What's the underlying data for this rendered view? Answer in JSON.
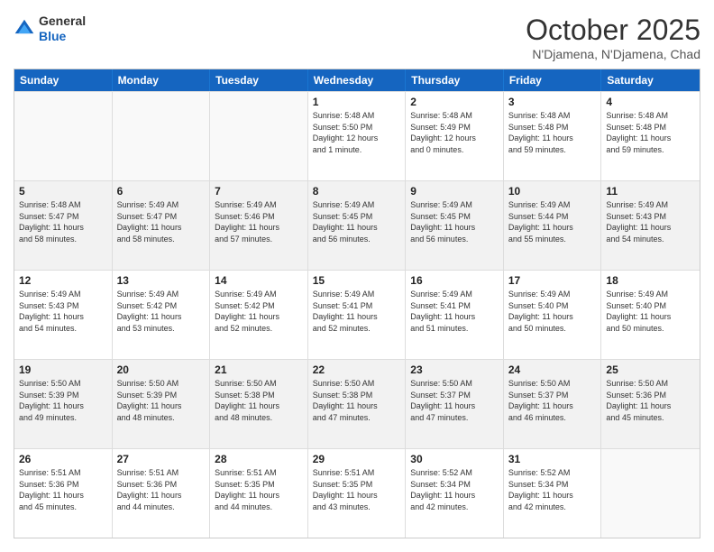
{
  "logo": {
    "general": "General",
    "blue": "Blue"
  },
  "header": {
    "month": "October 2025",
    "location": "N'Djamena, N'Djamena, Chad"
  },
  "days": [
    "Sunday",
    "Monday",
    "Tuesday",
    "Wednesday",
    "Thursday",
    "Friday",
    "Saturday"
  ],
  "rows": [
    [
      {
        "day": "",
        "text": ""
      },
      {
        "day": "",
        "text": ""
      },
      {
        "day": "",
        "text": ""
      },
      {
        "day": "1",
        "text": "Sunrise: 5:48 AM\nSunset: 5:50 PM\nDaylight: 12 hours\nand 1 minute."
      },
      {
        "day": "2",
        "text": "Sunrise: 5:48 AM\nSunset: 5:49 PM\nDaylight: 12 hours\nand 0 minutes."
      },
      {
        "day": "3",
        "text": "Sunrise: 5:48 AM\nSunset: 5:48 PM\nDaylight: 11 hours\nand 59 minutes."
      },
      {
        "day": "4",
        "text": "Sunrise: 5:48 AM\nSunset: 5:48 PM\nDaylight: 11 hours\nand 59 minutes."
      }
    ],
    [
      {
        "day": "5",
        "text": "Sunrise: 5:48 AM\nSunset: 5:47 PM\nDaylight: 11 hours\nand 58 minutes."
      },
      {
        "day": "6",
        "text": "Sunrise: 5:49 AM\nSunset: 5:47 PM\nDaylight: 11 hours\nand 58 minutes."
      },
      {
        "day": "7",
        "text": "Sunrise: 5:49 AM\nSunset: 5:46 PM\nDaylight: 11 hours\nand 57 minutes."
      },
      {
        "day": "8",
        "text": "Sunrise: 5:49 AM\nSunset: 5:45 PM\nDaylight: 11 hours\nand 56 minutes."
      },
      {
        "day": "9",
        "text": "Sunrise: 5:49 AM\nSunset: 5:45 PM\nDaylight: 11 hours\nand 56 minutes."
      },
      {
        "day": "10",
        "text": "Sunrise: 5:49 AM\nSunset: 5:44 PM\nDaylight: 11 hours\nand 55 minutes."
      },
      {
        "day": "11",
        "text": "Sunrise: 5:49 AM\nSunset: 5:43 PM\nDaylight: 11 hours\nand 54 minutes."
      }
    ],
    [
      {
        "day": "12",
        "text": "Sunrise: 5:49 AM\nSunset: 5:43 PM\nDaylight: 11 hours\nand 54 minutes."
      },
      {
        "day": "13",
        "text": "Sunrise: 5:49 AM\nSunset: 5:42 PM\nDaylight: 11 hours\nand 53 minutes."
      },
      {
        "day": "14",
        "text": "Sunrise: 5:49 AM\nSunset: 5:42 PM\nDaylight: 11 hours\nand 52 minutes."
      },
      {
        "day": "15",
        "text": "Sunrise: 5:49 AM\nSunset: 5:41 PM\nDaylight: 11 hours\nand 52 minutes."
      },
      {
        "day": "16",
        "text": "Sunrise: 5:49 AM\nSunset: 5:41 PM\nDaylight: 11 hours\nand 51 minutes."
      },
      {
        "day": "17",
        "text": "Sunrise: 5:49 AM\nSunset: 5:40 PM\nDaylight: 11 hours\nand 50 minutes."
      },
      {
        "day": "18",
        "text": "Sunrise: 5:49 AM\nSunset: 5:40 PM\nDaylight: 11 hours\nand 50 minutes."
      }
    ],
    [
      {
        "day": "19",
        "text": "Sunrise: 5:50 AM\nSunset: 5:39 PM\nDaylight: 11 hours\nand 49 minutes."
      },
      {
        "day": "20",
        "text": "Sunrise: 5:50 AM\nSunset: 5:39 PM\nDaylight: 11 hours\nand 48 minutes."
      },
      {
        "day": "21",
        "text": "Sunrise: 5:50 AM\nSunset: 5:38 PM\nDaylight: 11 hours\nand 48 minutes."
      },
      {
        "day": "22",
        "text": "Sunrise: 5:50 AM\nSunset: 5:38 PM\nDaylight: 11 hours\nand 47 minutes."
      },
      {
        "day": "23",
        "text": "Sunrise: 5:50 AM\nSunset: 5:37 PM\nDaylight: 11 hours\nand 47 minutes."
      },
      {
        "day": "24",
        "text": "Sunrise: 5:50 AM\nSunset: 5:37 PM\nDaylight: 11 hours\nand 46 minutes."
      },
      {
        "day": "25",
        "text": "Sunrise: 5:50 AM\nSunset: 5:36 PM\nDaylight: 11 hours\nand 45 minutes."
      }
    ],
    [
      {
        "day": "26",
        "text": "Sunrise: 5:51 AM\nSunset: 5:36 PM\nDaylight: 11 hours\nand 45 minutes."
      },
      {
        "day": "27",
        "text": "Sunrise: 5:51 AM\nSunset: 5:36 PM\nDaylight: 11 hours\nand 44 minutes."
      },
      {
        "day": "28",
        "text": "Sunrise: 5:51 AM\nSunset: 5:35 PM\nDaylight: 11 hours\nand 44 minutes."
      },
      {
        "day": "29",
        "text": "Sunrise: 5:51 AM\nSunset: 5:35 PM\nDaylight: 11 hours\nand 43 minutes."
      },
      {
        "day": "30",
        "text": "Sunrise: 5:52 AM\nSunset: 5:34 PM\nDaylight: 11 hours\nand 42 minutes."
      },
      {
        "day": "31",
        "text": "Sunrise: 5:52 AM\nSunset: 5:34 PM\nDaylight: 11 hours\nand 42 minutes."
      },
      {
        "day": "",
        "text": ""
      }
    ]
  ]
}
